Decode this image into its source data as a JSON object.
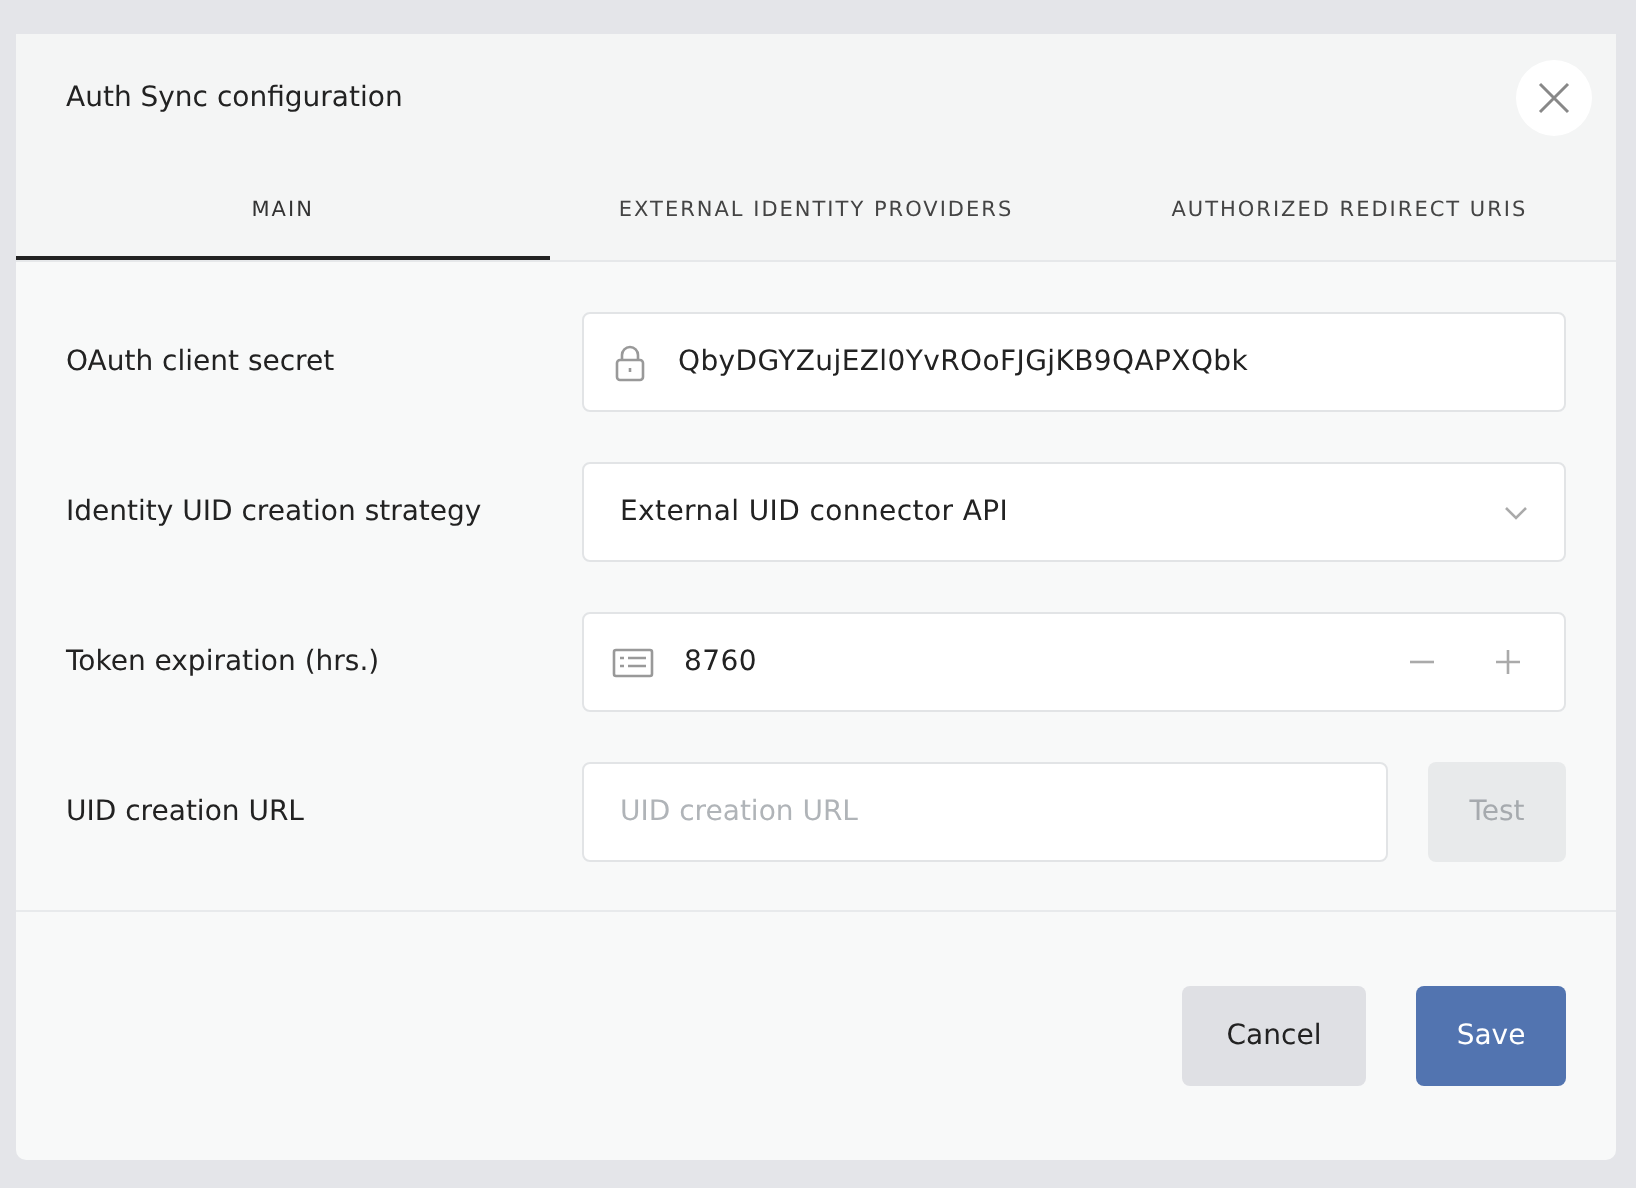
{
  "dialog": {
    "title": "Auth Sync configuration"
  },
  "tabs": [
    {
      "label": "MAIN",
      "selected": true
    },
    {
      "label": "EXTERNAL IDENTITY PROVIDERS",
      "selected": false
    },
    {
      "label": "AUTHORIZED REDIRECT URIS",
      "selected": false
    }
  ],
  "fields": [
    {
      "kind": "secret",
      "label": "OAuth client secret",
      "value": "QbyDGYZujEZl0YvROoFJGjKB9QAPXQbk"
    },
    {
      "kind": "select",
      "label": "Identity UID creation strategy",
      "value": "External UID connector API"
    },
    {
      "kind": "number",
      "label": "Token expiration (hrs.)",
      "value": "8760"
    },
    {
      "kind": "url",
      "label": "UID creation URL",
      "placeholder": "UID creation URL",
      "button": {
        "label": "Test",
        "disabled": true
      }
    }
  ],
  "buttons": [
    {
      "kind": "secondary",
      "label": "Cancel"
    },
    {
      "kind": "primary",
      "label": "Save"
    }
  ]
}
